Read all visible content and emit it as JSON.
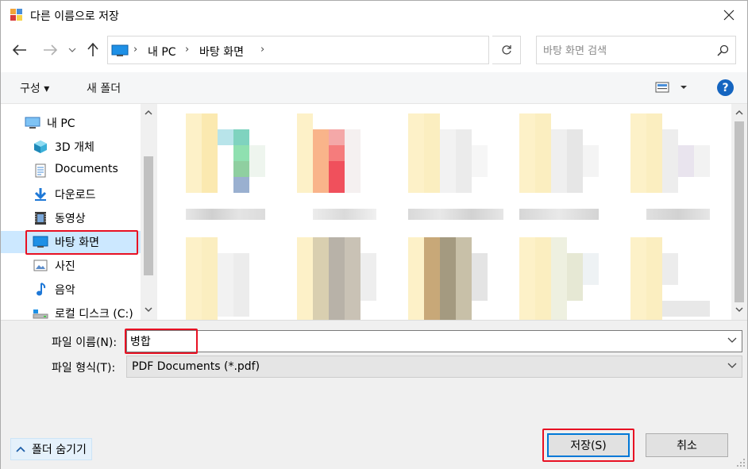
{
  "window": {
    "title": "다른 이름으로 저장"
  },
  "nav": {
    "breadcrumbs": [
      "내 PC",
      "바탕 화면"
    ],
    "search_placeholder": "바탕 화면 검색"
  },
  "toolbar": {
    "organize_label": "구성 ▾",
    "new_folder_label": "새 폴더",
    "help_label": "?"
  },
  "sidebar": {
    "items": [
      {
        "label": "내 PC",
        "icon": "pc-icon"
      },
      {
        "label": "3D 개체",
        "icon": "3d-objects-icon"
      },
      {
        "label": "Documents",
        "icon": "documents-icon"
      },
      {
        "label": "다운로드",
        "icon": "download-icon"
      },
      {
        "label": "동영상",
        "icon": "video-icon"
      },
      {
        "label": "바탕 화면",
        "icon": "desktop-icon",
        "selected": true
      },
      {
        "label": "사진",
        "icon": "pictures-icon"
      },
      {
        "label": "음악",
        "icon": "music-icon"
      },
      {
        "label": "로컬 디스크 (C:)",
        "icon": "local-disk-icon"
      }
    ]
  },
  "form": {
    "filename_label": "파일 이름(N):",
    "filename_value": "병합",
    "filetype_label": "파일 형식(T):",
    "filetype_value": "PDF Documents (*.pdf)"
  },
  "footer": {
    "hide_folders_label": "폴더 숨기기",
    "save_label": "저장(S)",
    "cancel_label": "취소"
  },
  "colors": {
    "highlight": "#e81123",
    "selection": "#cce8ff",
    "accent": "#0078d7"
  }
}
